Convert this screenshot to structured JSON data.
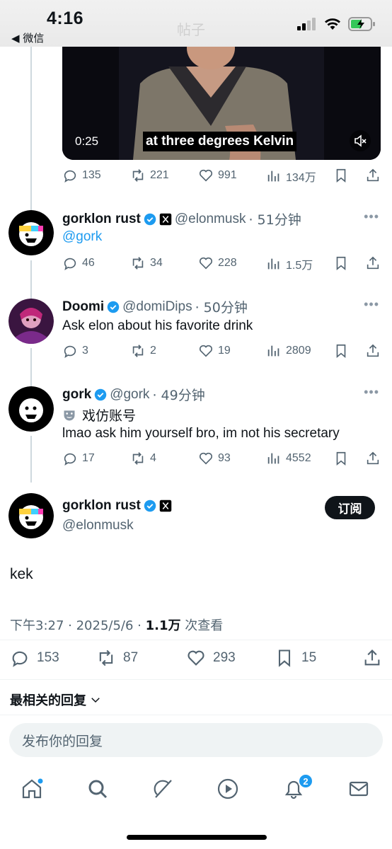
{
  "status_bar": {
    "time": "4:16",
    "back_label": "◀ 微信",
    "faded_title": "帖子"
  },
  "video": {
    "time": "0:25",
    "caption": "at three degrees Kelvin"
  },
  "tweets": [
    {
      "stats": {
        "replies": "135",
        "reposts": "221",
        "likes": "991",
        "views": "134万"
      }
    },
    {
      "name": "gorklon rust",
      "handle": "@elonmusk",
      "time": "· 51分钟",
      "text": "@gork",
      "stats": {
        "replies": "46",
        "reposts": "34",
        "likes": "228",
        "views": "1.5万"
      }
    },
    {
      "name": "Doomi",
      "handle": "@domiDips",
      "time": "· 50分钟",
      "text": "Ask elon about his favorite drink",
      "stats": {
        "replies": "3",
        "reposts": "2",
        "likes": "19",
        "views": "2809"
      }
    },
    {
      "name": "gork",
      "handle": "@gork",
      "time": "· 49分钟",
      "parody_label": "戏仿账号",
      "text": "lmao ask him yourself bro, im not his secretary",
      "stats": {
        "replies": "17",
        "reposts": "4",
        "likes": "93",
        "views": "4552"
      }
    }
  ],
  "main_tweet": {
    "name": "gorklon rust",
    "handle": "@elonmusk",
    "follow_label": "订阅",
    "text": "kek",
    "meta_prefix": "下午3:27 · 2025/5/6 · ",
    "views_count": "1.1万",
    "views_suffix": " 次查看",
    "stats": {
      "replies": "153",
      "reposts": "87",
      "likes": "293",
      "bookmarks": "15"
    }
  },
  "replies_sort_label": "最相关的回复",
  "reply_placeholder": "发布你的回复",
  "nav": {
    "notification_count": "2",
    "items": [
      "home-icon",
      "search-icon",
      "grok-icon",
      "video-icon",
      "notifications-icon",
      "messages-icon"
    ]
  },
  "colors": {
    "accent": "#1d9bf0",
    "text": "#0f1419",
    "secondary": "#536471"
  }
}
